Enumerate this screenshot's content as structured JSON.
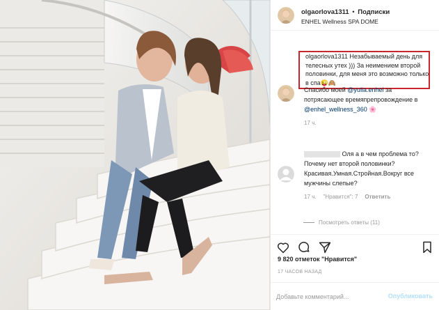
{
  "post": {
    "author": {
      "username": "olgaorlova1311",
      "separator": "•",
      "follow_label": "Подписки",
      "location": "ENHEL Wellness SPA DOME"
    },
    "caption": {
      "username": "olgaorlova1311",
      "text": "Незабываемый день для телесных утех ))) За неимением второй половинки, для меня это возможно только в спа😜🙈"
    },
    "comments": [
      {
        "avatar_icon": "user-avatar-icon",
        "text_before": "Спасибо моей ",
        "mention1": "@yulia.enhel",
        "text_mid": " за потрясающее времяпрепровождение в ",
        "mention2": "@enhel_wellness_360",
        "emoji": "🌸",
        "time": "17 ч."
      },
      {
        "avatar_icon": "default-avatar-icon",
        "username": "",
        "text": "Оля а в чем проблема то?Почему нет второй половинки? Красивая.Умная.Стройная.Вокруг все мужчины слепые?",
        "time": "17 ч.",
        "likes": "\"Нравится\": 7",
        "reply_label": "Ответить"
      }
    ],
    "view_replies": "Посмотреть ответы (11)",
    "actions": {
      "like_icon": "heart-icon",
      "comment_icon": "comment-icon",
      "share_icon": "share-icon",
      "save_icon": "bookmark-icon"
    },
    "likes_text": "9 820 отметок \"Нравится\"",
    "time_ago": "17 ЧАСОВ НАЗАД",
    "add_comment": {
      "placeholder": "Добавьте комментарий...",
      "publish_label": "Опубликовать"
    }
  },
  "colors": {
    "highlight_box": "#c9252c",
    "mention": "#003569",
    "publish_disabled": "#b2dffc",
    "meta_gray": "#999999"
  }
}
